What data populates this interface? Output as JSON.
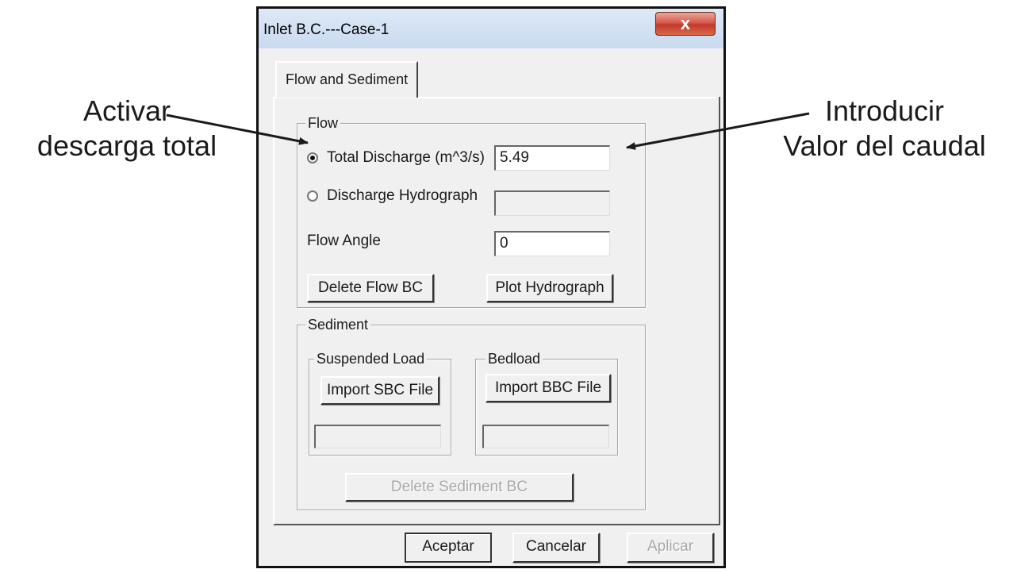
{
  "annotations": {
    "left_line1": "Activar",
    "left_line2": "descarga total",
    "right_line1": "Introducir",
    "right_line2": "Valor del caudal"
  },
  "window": {
    "title": "Inlet B.C.---Case-1",
    "close_glyph": "x"
  },
  "tabs": [
    {
      "label": "Flow and Sediment",
      "selected": true
    }
  ],
  "flow": {
    "group_label": "Flow",
    "total_discharge_label": "Total Discharge (m^3/s)",
    "total_discharge_value": "5.49",
    "total_discharge_selected": true,
    "hydrograph_label": "Discharge Hydrograph",
    "hydrograph_value": "",
    "flow_angle_label": "Flow Angle",
    "flow_angle_value": "0",
    "delete_button": "Delete Flow BC",
    "plot_button": "Plot Hydrograph"
  },
  "sediment": {
    "group_label": "Sediment",
    "suspended_group_label": "Suspended Load",
    "import_sbc_button": "Import SBC File",
    "sbc_file_value": "",
    "bedload_group_label": "Bedload",
    "import_bbc_button": "Import BBC File",
    "bbc_file_value": "",
    "delete_button": "Delete Sediment BC"
  },
  "footer": {
    "ok_button": "Aceptar",
    "cancel_button": "Cancelar",
    "apply_button": "Aplicar"
  },
  "colors": {
    "titlebar": "#c9daef",
    "close_button": "#c3382a",
    "dialog_face": "#f0f0f0"
  }
}
